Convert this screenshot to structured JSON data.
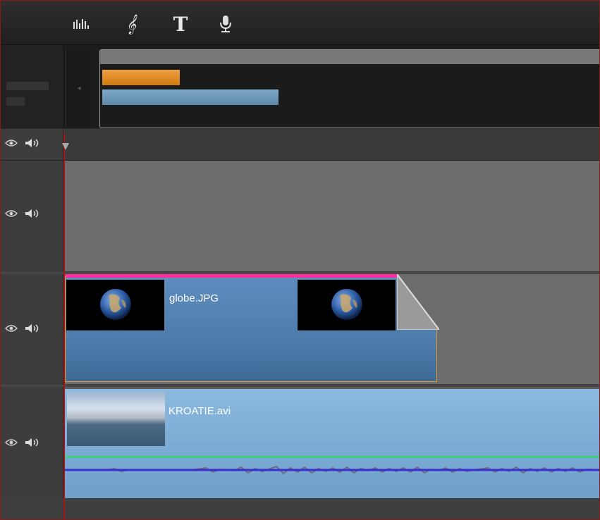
{
  "toolbar": {
    "icons": [
      "audio-levels-icon",
      "treble-clef-icon",
      "text-title-icon",
      "microphone-icon"
    ]
  },
  "tracks": [
    {
      "clip": null
    },
    {
      "clip": {
        "name": "globe.JPG"
      }
    },
    {
      "clip": {
        "name": "KROATIE.avi"
      }
    }
  ],
  "colors": {
    "selection_accent": "#ff2e9a",
    "clip_border": "#e39a2b",
    "video_clip": "#5e8dbf",
    "audio_clip": "#7aaad4",
    "volume_line": "#3ad07a",
    "playhead": "#a01818"
  }
}
